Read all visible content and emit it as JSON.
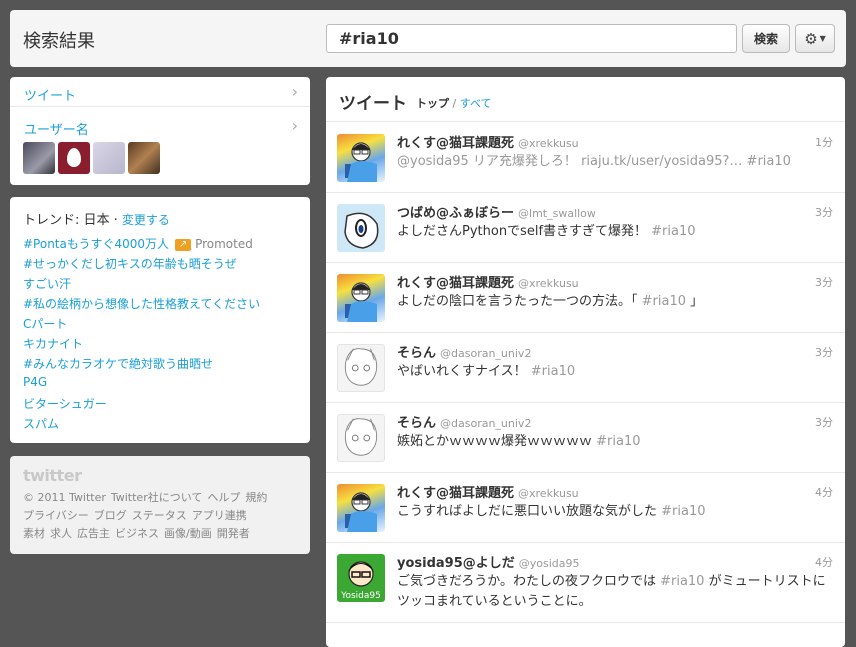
{
  "header": {
    "title": "検索結果",
    "search_value": "#ria10",
    "search_button": "検索",
    "settings_icon": "gear-icon"
  },
  "sidebar": {
    "nav": [
      {
        "label": "ツイート",
        "icon": "chevron-right-icon"
      },
      {
        "label": "ユーザー名",
        "icon": "chevron-right-icon"
      }
    ]
  },
  "trends": {
    "title": "トレンド: 日本",
    "change": "変更する",
    "items": [
      "#Pontaもうすぐ4000万人",
      "#せっかくだし初キスの年齢も晒そうぜ",
      "すごい汗",
      "#私の絵柄から想像した性格教えてください",
      "Cパート",
      "キカナイト",
      "#みんなカラオケで絶対歌う曲晒せ",
      "P4G",
      "ビターシュガー",
      "スパム"
    ],
    "promoted_label": "Promoted"
  },
  "footer": {
    "logo": "twitter",
    "links": [
      "© 2011 Twitter",
      "Twitter社について",
      "ヘルプ",
      "規約",
      "プライバシー",
      "ブログ",
      "ステータス",
      "アプリ連携",
      "素材",
      "求人",
      "広告主",
      "ビジネス",
      "画像/動画",
      "開発者"
    ]
  },
  "main": {
    "title": "ツイート",
    "tab_top": "トップ",
    "tab_sep": "/",
    "tab_all": "すべて",
    "tweets": [
      {
        "name": "れくす@猫耳課題死",
        "handle": "@xrekkusu",
        "time": "1分",
        "pre": "@yosida95 リア充爆発しろ！ ",
        "link": "riaju.tk/user/yosida95?…",
        "tag": "#ria10",
        "post": ""
      },
      {
        "name": "つばめ@ふぁぼらー",
        "handle": "@lmt_swallow",
        "time": "3分",
        "pre": "よしださんPythonでself書きすぎて爆発！ ",
        "link": "",
        "tag": "#ria10",
        "post": ""
      },
      {
        "name": "れくす@猫耳課題死",
        "handle": "@xrekkusu",
        "time": "3分",
        "pre": "よしだの陰口を言うたった一つの方法。「 ",
        "link": "",
        "tag": "#ria10",
        "post": " 」"
      },
      {
        "name": "そらん",
        "handle": "@dasoran_univ2",
        "time": "3分",
        "pre": "やばいれくすナイス！ ",
        "link": "",
        "tag": "#ria10",
        "post": ""
      },
      {
        "name": "そらん",
        "handle": "@dasoran_univ2",
        "time": "3分",
        "pre": "嫉妬とかｗｗｗｗ爆発ｗｗｗｗｗ ",
        "link": "",
        "tag": "#ria10",
        "post": ""
      },
      {
        "name": "れくす@猫耳課題死",
        "handle": "@xrekkusu",
        "time": "4分",
        "pre": "こうすればよしだに悪口いい放題な気がした ",
        "link": "",
        "tag": "#ria10",
        "post": ""
      },
      {
        "name": "yosida95@よしだ",
        "handle": "@yosida95",
        "time": "4分",
        "pre": "ご気づきだろうか。わたしの夜フクロウでは ",
        "link": "",
        "tag": "#ria10",
        "post": " がミュートリストにツッコまれているということに。"
      }
    ]
  }
}
